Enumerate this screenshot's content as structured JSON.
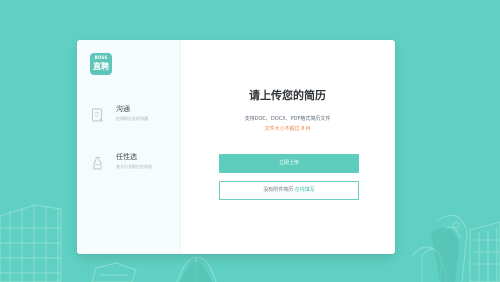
{
  "colors": {
    "background": "#5fd0c3",
    "brand": "#5ecdbd",
    "warning": "#ef8146",
    "text_primary": "#2f3337",
    "text_secondary": "#6c7780"
  },
  "logo": {
    "top_text": "BOSS",
    "bottom_text": "直聘",
    "icon_name": "boss-logo-icon"
  },
  "sidebar": {
    "features": [
      {
        "title": "沟通",
        "description": "在线职位及时沟通",
        "icon_name": "chat-card-icon"
      },
      {
        "title": "任性选",
        "description": "各大行业职位任你选",
        "icon_name": "bottle-icon"
      }
    ]
  },
  "upload": {
    "heading": "请上传您的简历",
    "formats_text": "支持DOC、DOCX、PDF格式简历文件",
    "size_limit_text": "文件大小不超过 8 M",
    "upload_button_label": "立即上传",
    "online_prefix": "没有附件简历",
    "online_link": "在线填写"
  }
}
